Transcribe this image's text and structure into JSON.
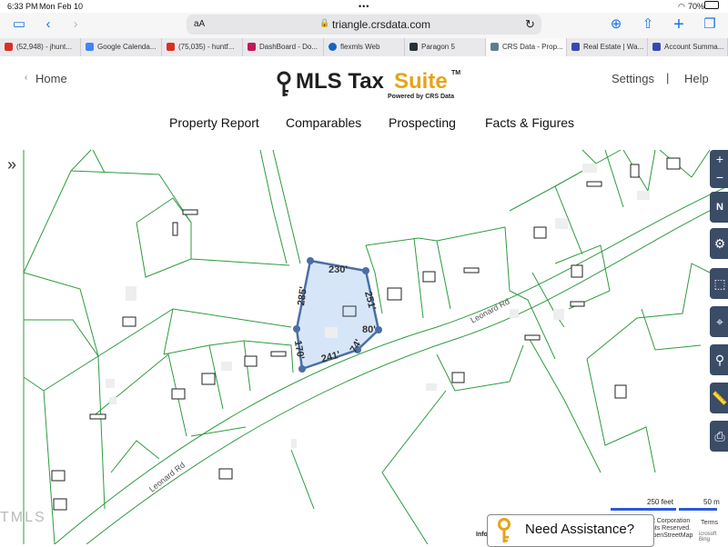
{
  "status_bar": {
    "time": "6:33 PM",
    "date": "Mon Feb 10",
    "battery": "70%"
  },
  "browser": {
    "text_size": "aA",
    "url": "triangle.crsdata.com",
    "tabs": [
      {
        "label": "(52,948) - jhunt...",
        "color": "#d93025"
      },
      {
        "label": "Google Calenda...",
        "color": "#4285f4"
      },
      {
        "label": "(75,035) - huntf...",
        "color": "#d93025"
      },
      {
        "label": "DashBoard - Do...",
        "color": "#c2185b"
      },
      {
        "label": "flexmls Web",
        "color": "#1565c0"
      },
      {
        "label": "Paragon 5",
        "color": "#263238"
      },
      {
        "label": "CRS Data - Prop...",
        "color": "#607d8b"
      },
      {
        "label": "Real Estate | Wa...",
        "color": "#3949ab"
      },
      {
        "label": "Account Summa...",
        "color": "#3949ab"
      }
    ]
  },
  "site": {
    "home_label": "Home",
    "logo_main": "MLS Tax ",
    "logo_accent": "Suite",
    "logo_tm": "TM",
    "logo_sub": "Powered by CRS Data",
    "settings_label": "Settings",
    "separator": "|",
    "help_label": "Help",
    "nav": [
      "Property Report",
      "Comparables",
      "Prospecting",
      "Facts & Figures"
    ]
  },
  "map": {
    "dimensions": [
      "230'",
      "251'",
      "80'",
      "74'",
      "241'",
      "170'",
      "285'"
    ],
    "road_label": "Leonard Rd",
    "scale_feet": "250 feet",
    "scale_meters": "50 m",
    "attribution_1": "oft Corporation",
    "attribution_2": "ghts Reserved.",
    "attribution_3": "OpenStreetMap",
    "attribution_4": "icrosoft Bing",
    "terms": "Terms",
    "info": "Info",
    "watermark": "TMLS",
    "assist_label": "Need Assistance?",
    "control_north": "N",
    "parcel_fill": "#cfe2f7",
    "parcel_stroke": "#4a6fa5",
    "line_color": "#2e9b3f"
  }
}
